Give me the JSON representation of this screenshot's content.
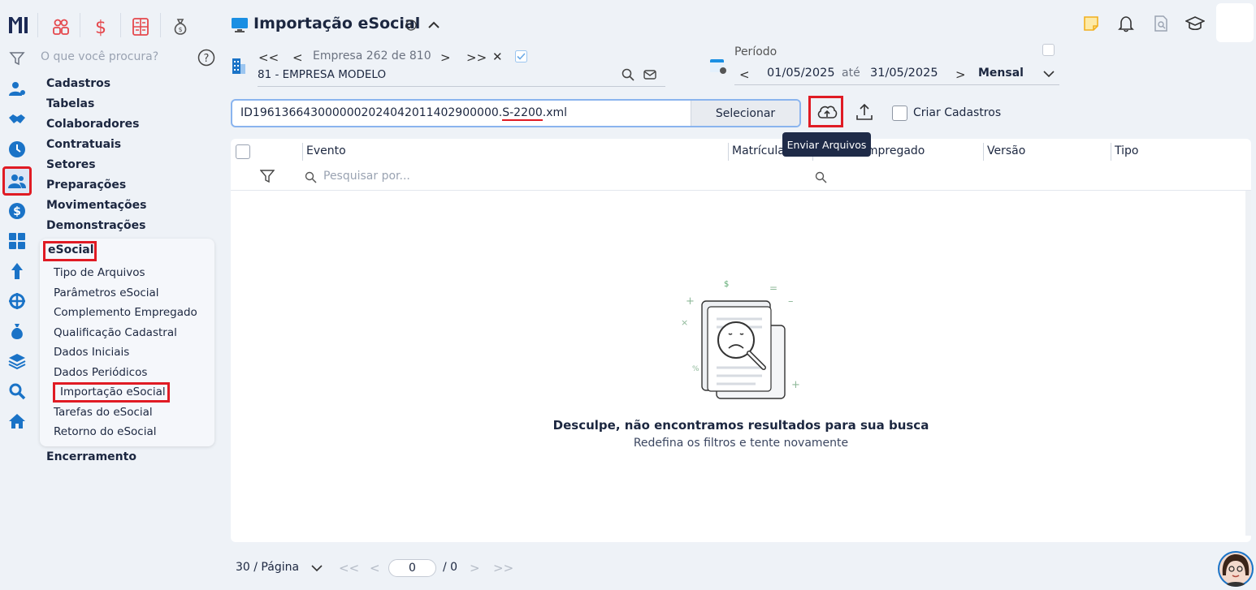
{
  "search": {
    "placeholder": "O que você procura?"
  },
  "menu": {
    "items": [
      "Cadastros",
      "Tabelas",
      "Colaboradores",
      "Contratuais",
      "Setores",
      "Preparações",
      "Movimentações",
      "Demonstrações"
    ],
    "esocial_label": "eSocial",
    "esocial_items": [
      "Tipo de Arquivos",
      "Parâmetros eSocial",
      "Complemento Empregado",
      "Qualificação Cadastral",
      "Dados Iniciais",
      "Dados Periódicos",
      "Importação eSocial",
      "Tarefas do eSocial",
      "Retorno do eSocial"
    ],
    "after_item": "Encerramento"
  },
  "header": {
    "title": "Importação eSocial"
  },
  "company": {
    "nav_text": "Empresa 262 de 810",
    "name": "81 - EMPRESA MODELO"
  },
  "period": {
    "label": "Período",
    "start": "01/05/2025",
    "sep": "até",
    "end": "31/05/2025",
    "mode": "Mensal"
  },
  "file": {
    "name_prefix": "ID1961366430000002024042011402900000.",
    "name_highlight": "S-2200",
    "name_suffix": ".xml",
    "select_label": "Selecionar"
  },
  "toolbar": {
    "tooltip": "Enviar Arquivos",
    "criar_cadastros": "Criar Cadastros"
  },
  "table": {
    "columns": [
      "Evento",
      "Matrícula",
      "Pessoa/Empregado",
      "Versão",
      "Tipo"
    ],
    "search_placeholder": "Pesquisar por...",
    "empty_title": "Desculpe, não encontramos resultados para sua busca",
    "empty_sub": "Redefina os filtros e tente novamente"
  },
  "pagination": {
    "per_page": "30 / Página",
    "current": "0",
    "total": "/ 0"
  },
  "colors": {
    "accent": "#e01b24",
    "brand": "#1e3a8a",
    "icon_blue": "#1a73c7"
  }
}
